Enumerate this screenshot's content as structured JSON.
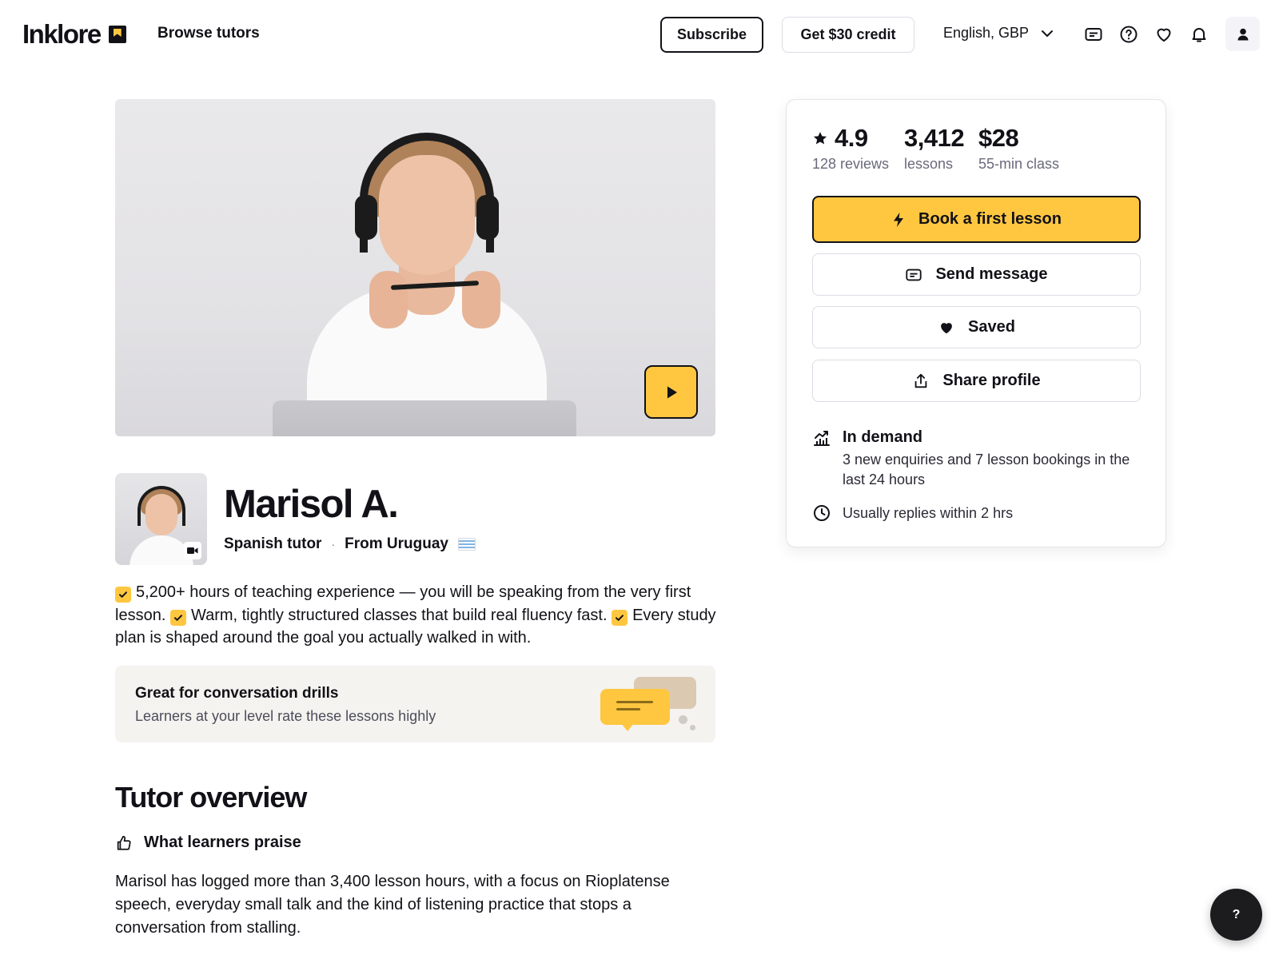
{
  "header": {
    "logo_text": "Inklore",
    "nav_browse": "Browse tutors",
    "subscribe_label": "Subscribe",
    "credit_label": "Get $30 credit",
    "language": "English, GBP",
    "icons": [
      "messages-icon",
      "help-circle-icon",
      "heart-icon",
      "bell-icon",
      "user-icon"
    ]
  },
  "tutor": {
    "name": "Marisol A.",
    "subject": "Spanish tutor",
    "separator": "·",
    "origin": "From Uruguay",
    "flag": "uruguay-flag"
  },
  "bio": {
    "points": [
      "5,200+ hours of teaching experience — you will be speaking from the very first lesson.",
      "Warm, tightly structured classes that build real fluency fast.",
      "Every study plan is shaped around the goal you actually walked in with."
    ]
  },
  "highlight": {
    "title": "Great for conversation drills",
    "subtitle": "Learners at your level rate these lessons highly"
  },
  "overview": {
    "title": "Tutor overview",
    "praise_heading": "What learners praise",
    "text": "Marisol has logged more than 3,400 lesson hours, with a focus on Rioplatense speech, everyday small talk and the kind of listening practice that stops a conversation from stalling."
  },
  "sidebar": {
    "rating": "4.9",
    "reviews": "128 reviews",
    "lessons_count": "3,412",
    "lessons_label": "lessons",
    "price": "$28",
    "price_label": "55-min class",
    "book_label": "Book a first lesson",
    "message_label": "Send message",
    "saved_label": "Saved",
    "share_label": "Share profile",
    "demand_title": "In demand",
    "demand_text": "3 new enquiries and 7 lesson bookings in the last 24 hours",
    "reply_text": "Usually replies within 2 hrs"
  },
  "help_fab": "?",
  "colors": {
    "accent": "#ffc740",
    "text": "#121117",
    "muted": "#6a697c",
    "highlight_bg": "#f4f3ef"
  }
}
